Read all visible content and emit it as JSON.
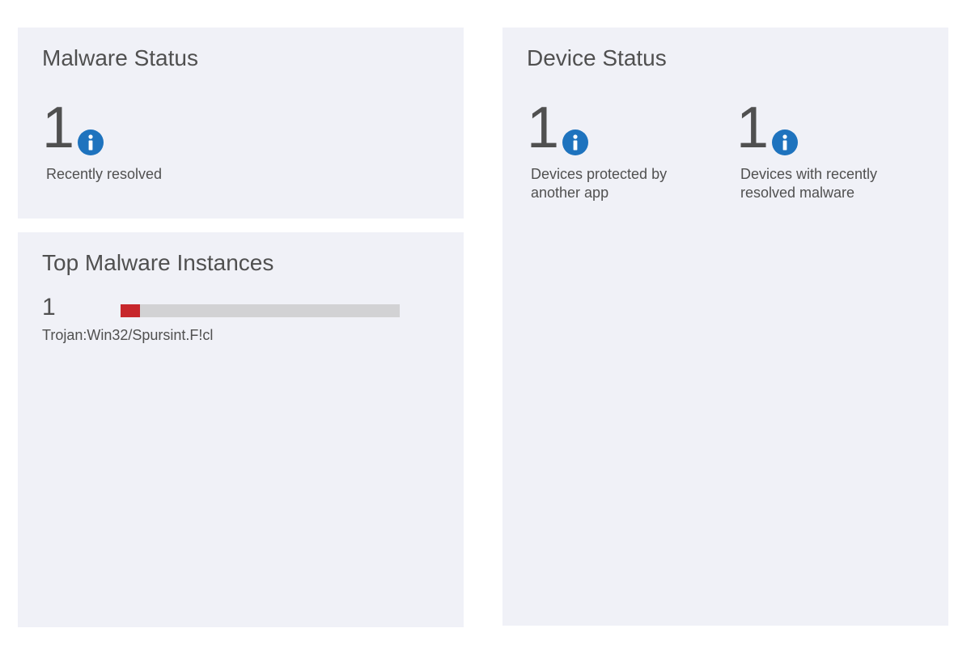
{
  "malware_status": {
    "title": "Malware Status",
    "recently_resolved": {
      "value": "1",
      "label": "Recently resolved"
    }
  },
  "top_malware": {
    "title": "Top Malware Instances",
    "instances": [
      {
        "count": "1",
        "name": "Trojan:Win32/Spursint.F!cl",
        "share_percent": 7,
        "bar_color": "#c7272c"
      }
    ]
  },
  "device_status": {
    "title": "Device Status",
    "metrics": [
      {
        "value": "1",
        "label": "Devices protected by another app"
      },
      {
        "value": "1",
        "label": "Devices with recently resolved malware"
      }
    ]
  },
  "colors": {
    "tile_background": "#f0f1f7",
    "info_icon": "#1e73be",
    "bar_track": "#d2d2d4"
  }
}
